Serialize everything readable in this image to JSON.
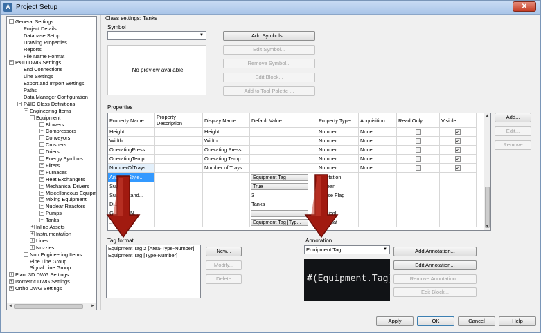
{
  "window": {
    "title": "Project Setup",
    "close_glyph": "✕",
    "app_icon": "A"
  },
  "tree": {
    "nodes": [
      {
        "label": "General Settings",
        "level": 0,
        "expander": "−"
      },
      {
        "label": "Project Details",
        "level": 1,
        "expander": ""
      },
      {
        "label": "Database Setup",
        "level": 1,
        "expander": ""
      },
      {
        "label": "Drawing Properties",
        "level": 1,
        "expander": ""
      },
      {
        "label": "Reports",
        "level": 1,
        "expander": ""
      },
      {
        "label": "File Name Format",
        "level": 1,
        "expander": ""
      },
      {
        "label": "P&ID DWG Settings",
        "level": 0,
        "expander": "−"
      },
      {
        "label": "End Connections",
        "level": 1,
        "expander": ""
      },
      {
        "label": "Line Settings",
        "level": 1,
        "expander": ""
      },
      {
        "label": "Export and Import Settings",
        "level": 1,
        "expander": ""
      },
      {
        "label": "Paths",
        "level": 1,
        "expander": ""
      },
      {
        "label": "Data Manager Configuration",
        "level": 1,
        "expander": ""
      },
      {
        "label": "P&ID Class Definitions",
        "level": 1,
        "expander": "−"
      },
      {
        "label": "Engineering Items",
        "level": 2,
        "expander": "−"
      },
      {
        "label": "Equipment",
        "level": 3,
        "expander": "−"
      },
      {
        "label": "Blowers",
        "level": 4,
        "expander": "+"
      },
      {
        "label": "Compressors",
        "level": 4,
        "expander": "+"
      },
      {
        "label": "Conveyors",
        "level": 4,
        "expander": "+"
      },
      {
        "label": "Crushers",
        "level": 4,
        "expander": "+"
      },
      {
        "label": "Driers",
        "level": 4,
        "expander": "+"
      },
      {
        "label": "Energy Symbols",
        "level": 4,
        "expander": "+"
      },
      {
        "label": "Filters",
        "level": 4,
        "expander": "+"
      },
      {
        "label": "Furnaces",
        "level": 4,
        "expander": "+"
      },
      {
        "label": "Heat Exchangers",
        "level": 4,
        "expander": "+"
      },
      {
        "label": "Mechanical Drivers",
        "level": 4,
        "expander": "+"
      },
      {
        "label": "Miscellaneous Equipme",
        "level": 4,
        "expander": "+"
      },
      {
        "label": "Mixing Equipment",
        "level": 4,
        "expander": "+"
      },
      {
        "label": "Nuclear Reactors",
        "level": 4,
        "expander": "+"
      },
      {
        "label": "Pumps",
        "level": 4,
        "expander": "+"
      },
      {
        "label": "Tanks",
        "level": 4,
        "expander": "+"
      },
      {
        "label": "Inline Assets",
        "level": 3,
        "expander": "+"
      },
      {
        "label": "Instrumentation",
        "level": 3,
        "expander": "+"
      },
      {
        "label": "Lines",
        "level": 3,
        "expander": "+"
      },
      {
        "label": "Nozzles",
        "level": 3,
        "expander": "+"
      },
      {
        "label": "Non Engineering Items",
        "level": 2,
        "expander": "+"
      },
      {
        "label": "Pipe Line Group",
        "level": 2,
        "expander": ""
      },
      {
        "label": "Signal Line Group",
        "level": 2,
        "expander": ""
      },
      {
        "label": "Plant 3D DWG Settings",
        "level": 0,
        "expander": "+"
      },
      {
        "label": "Isometric DWG Settings",
        "level": 0,
        "expander": "+"
      },
      {
        "label": "Ortho DWG Settings",
        "level": 0,
        "expander": "+"
      }
    ],
    "scroll_left": "◄",
    "scroll_right": "►"
  },
  "class_settings": {
    "title": "Class settings: Tanks"
  },
  "symbol": {
    "label": "Symbol",
    "combo_value": "",
    "preview_text": "No preview available",
    "buttons": {
      "add": "Add Symbols...",
      "edit": "Edit Symbol...",
      "remove": "Remove Symbol...",
      "edit_block": "Edit Block...",
      "add_palette": "Add to Tool Palette ..."
    }
  },
  "properties": {
    "label": "Properties",
    "headers": [
      "Property Name",
      "Property Description",
      "Display Name",
      "Default Value",
      "Property Type",
      "Acquisition",
      "Read Only",
      "Visible"
    ],
    "rows": [
      {
        "name": "Height",
        "desc": "",
        "display": "Height",
        "default": "",
        "type": "Number",
        "acq": "None",
        "ro": "",
        "vis": "✓",
        "has_checks": true
      },
      {
        "name": "Width",
        "desc": "",
        "display": "Width",
        "default": "",
        "type": "Number",
        "acq": "None",
        "ro": "",
        "vis": "✓",
        "has_checks": true
      },
      {
        "name": "OperatingPress...",
        "desc": "",
        "display": "Operating Press...",
        "default": "",
        "type": "Number",
        "acq": "None",
        "ro": "",
        "vis": "✓",
        "has_checks": true
      },
      {
        "name": "OperatingTemp...",
        "desc": "",
        "display": "Operating Temp...",
        "default": "",
        "type": "Number",
        "acq": "None",
        "ro": "",
        "vis": "✓",
        "has_checks": true
      },
      {
        "name": "NumberOfTrays",
        "desc": "",
        "display": "Number of Trays",
        "default": "",
        "type": "Number",
        "acq": "None",
        "ro": "",
        "vis": "✓",
        "has_checks": true
      },
      {
        "name": "An...tionStyle...",
        "desc": "",
        "display": "",
        "default": "Equipment Tag",
        "type": "...notation",
        "acq": "",
        "ro": "",
        "vis": "",
        "has_checks": false
      },
      {
        "name": "Su...tion",
        "desc": "",
        "display": "",
        "default": "True",
        "type": "...olean",
        "acq": "",
        "ro": "",
        "vis": "",
        "has_checks": false
      },
      {
        "name": "Su...edStand...",
        "desc": "",
        "display": "",
        "default": "3",
        "type": "...wise Flag",
        "acq": "",
        "ro": "",
        "vis": "",
        "has_checks": false
      },
      {
        "name": "Di...ame",
        "desc": "",
        "display": "",
        "default": "Tanks",
        "type": "...ng",
        "acq": "",
        "ro": "",
        "vis": "",
        "has_checks": false
      },
      {
        "name": "G...lStyleN...",
        "desc": "",
        "display": "",
        "default": "",
        "type": "...phical",
        "acq": "",
        "ro": "",
        "vis": "",
        "has_checks": false
      },
      {
        "name": "...Name",
        "desc": "",
        "display": "",
        "default": "Equipment Tag [Typ...",
        "type": "...format",
        "acq": "",
        "ro": "",
        "vis": "",
        "has_checks": false
      }
    ],
    "buttons": {
      "add": "Add...",
      "edit": "Edit...",
      "remove": "Remove"
    },
    "scroll_up": "▲",
    "scroll_down": "▼"
  },
  "tag_format": {
    "label": "Tag format",
    "items": [
      "Equipment Tag 2 [Area-Type-Number]",
      "Equipment Tag [Type-Number]"
    ],
    "buttons": {
      "new": "New...",
      "modify": "Modify...",
      "delete": "Delete"
    }
  },
  "annotation": {
    "label": "Annotation",
    "combo_value": "Equipment Tag",
    "preview_text": "#(Equipment.Tag)",
    "buttons": {
      "add": "Add Annotation...",
      "edit": "Edit Annotation...",
      "remove": "Remove Annotation...",
      "edit_block": "Edit Block..."
    }
  },
  "footer": {
    "apply": "Apply",
    "ok": "OK",
    "cancel": "Cancel",
    "help": "Help"
  },
  "colors": {
    "selection": "#cce8ff",
    "arrow_fill": "#a11a10",
    "arrow_dark": "#6d0c06",
    "preview_bg": "#111316"
  }
}
